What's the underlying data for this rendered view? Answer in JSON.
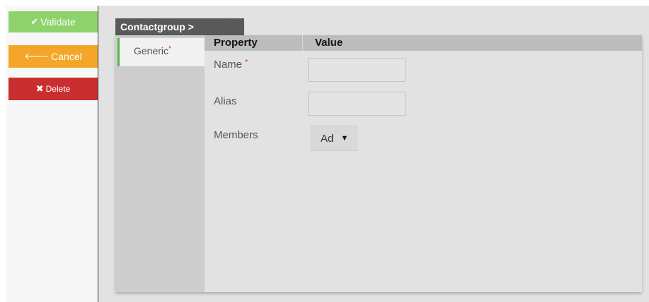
{
  "sidebar": {
    "validate_label": "Validate",
    "cancel_label": "Cancel",
    "delete_label": "Delete",
    "validate_icon": "check-icon",
    "cancel_icon": "arrow-left-icon",
    "delete_icon": "x-icon"
  },
  "breadcrumb": {
    "text": "Contactgroup >"
  },
  "tabs": [
    {
      "label": "Generic",
      "required": "*"
    }
  ],
  "grid": {
    "header_property": "Property",
    "header_value": "Value",
    "rows": [
      {
        "label": "Name",
        "required": "*",
        "value": ""
      },
      {
        "label": "Alias",
        "value": ""
      },
      {
        "label": "Members",
        "selected": "Ad"
      }
    ]
  },
  "colors": {
    "validate": "#8ed26b",
    "cancel": "#f4a62a",
    "delete": "#c92f2f",
    "tab_accent": "#57b848",
    "required": "#e02020"
  }
}
